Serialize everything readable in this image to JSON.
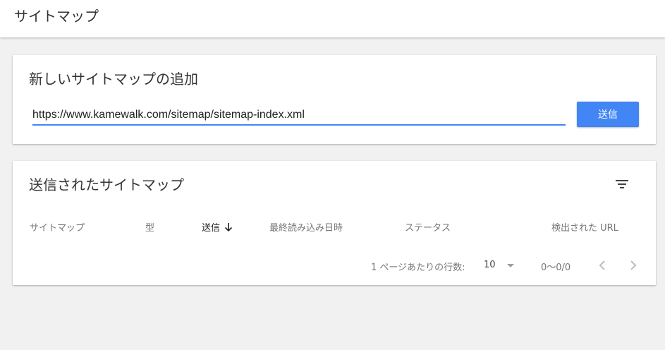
{
  "header": {
    "title": "サイトマップ"
  },
  "add_sitemap": {
    "title": "新しいサイトマップの追加",
    "url_value": "https://www.kamewalk.com/sitemap/sitemap-index.xml",
    "submit_label": "送信"
  },
  "submitted_sitemaps": {
    "title": "送信されたサイトマップ",
    "filter_icon": "filter-icon",
    "columns": [
      {
        "label": "サイトマップ"
      },
      {
        "label": "型"
      },
      {
        "label": "送信",
        "sorted": "desc"
      },
      {
        "label": "最終読み込み日時"
      },
      {
        "label": "ステータス"
      },
      {
        "label": "検出された URL"
      }
    ],
    "pagination": {
      "rows_per_page_label": "1 ページあたりの行数:",
      "rows_per_page_value": "10",
      "range": "0〜0/0"
    }
  },
  "colors": {
    "accent": "#4285f4",
    "background": "#f1f1f1",
    "card": "#ffffff"
  }
}
